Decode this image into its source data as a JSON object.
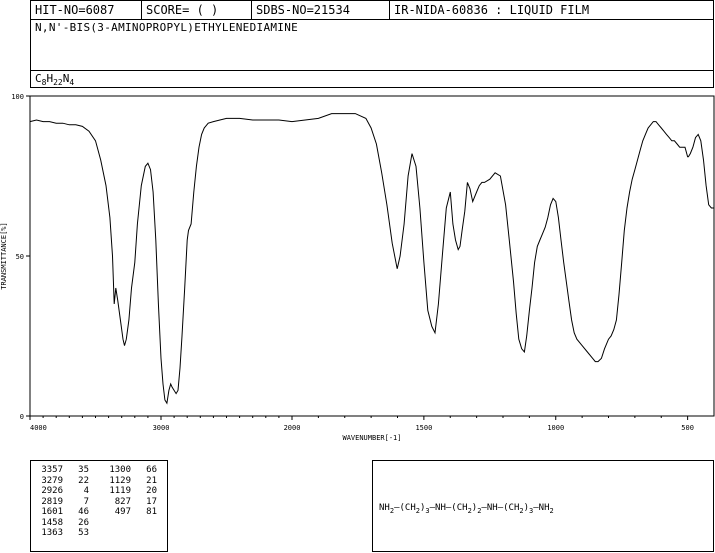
{
  "header": {
    "hit_no": "HIT-NO=6087",
    "score": "SCORE=  (  )",
    "sdbs_no": "SDBS-NO=21534",
    "ir": "IR-NIDA-60836 : LIQUID FILM"
  },
  "compound": {
    "name": "N,N'-BIS(3-AMINOPROPYL)ETHYLENEDIAMINE",
    "formula_c": "C",
    "formula_c_sub": "8",
    "formula_h": "H",
    "formula_h_sub": "22",
    "formula_n": "N",
    "formula_n_sub": "4"
  },
  "chart_data": {
    "type": "line",
    "title": "",
    "xlabel": "WAVENUMBER[-1]",
    "ylabel": "TRANSMITTANCE[%]",
    "xlim": [
      4000,
      400
    ],
    "ylim": [
      0,
      100
    ],
    "x_ticks": [
      4000,
      3000,
      2000,
      1500,
      1000,
      500
    ],
    "y_ticks": [
      0,
      50,
      100
    ],
    "series": [
      {
        "x": [
          4000,
          3950,
          3900,
          3850,
          3800,
          3750,
          3700,
          3650,
          3600,
          3550,
          3500,
          3460,
          3420,
          3390,
          3370,
          3357,
          3345,
          3330,
          3310,
          3290,
          3279,
          3265,
          3245,
          3225,
          3200,
          3180,
          3150,
          3120,
          3100,
          3080,
          3060,
          3040,
          3020,
          3000,
          2985,
          2970,
          2955,
          2940,
          2926,
          2915,
          2900,
          2885,
          2870,
          2855,
          2840,
          2819,
          2800,
          2790,
          2770,
          2750,
          2730,
          2710,
          2690,
          2670,
          2640,
          2600,
          2550,
          2500,
          2450,
          2400,
          2300,
          2200,
          2100,
          2000,
          1900,
          1850,
          1800,
          1760,
          1720,
          1700,
          1680,
          1660,
          1640,
          1620,
          1601,
          1590,
          1575,
          1560,
          1545,
          1530,
          1515,
          1500,
          1485,
          1470,
          1458,
          1445,
          1430,
          1415,
          1400,
          1390,
          1380,
          1370,
          1363,
          1355,
          1345,
          1335,
          1325,
          1315,
          1300,
          1290,
          1280,
          1270,
          1250,
          1230,
          1210,
          1190,
          1175,
          1160,
          1150,
          1140,
          1129,
          1119,
          1110,
          1100,
          1090,
          1080,
          1070,
          1060,
          1050,
          1040,
          1030,
          1020,
          1010,
          1000,
          990,
          980,
          970,
          960,
          950,
          940,
          930,
          920,
          900,
          880,
          860,
          850,
          840,
          827,
          815,
          800,
          790,
          780,
          770,
          760,
          750,
          740,
          730,
          720,
          710,
          700,
          690,
          680,
          670,
          660,
          650,
          640,
          630,
          620,
          610,
          600,
          590,
          580,
          570,
          560,
          550,
          540,
          530,
          520,
          510,
          500,
          497,
          490,
          480,
          470,
          460,
          450,
          440,
          430,
          420,
          410,
          400
        ],
        "y": [
          92,
          92.5,
          92,
          92,
          91.5,
          91.5,
          91,
          91,
          90.5,
          89,
          86,
          80,
          72,
          62,
          50,
          35,
          40,
          36,
          30,
          24,
          22,
          24,
          30,
          40,
          48,
          60,
          72,
          78,
          79,
          77,
          70,
          55,
          35,
          18,
          10,
          5,
          4,
          8,
          10,
          9,
          8,
          7,
          8,
          15,
          25,
          40,
          55,
          58,
          60,
          70,
          78,
          84,
          88,
          90,
          91.5,
          92,
          92.5,
          93,
          93,
          93,
          92.5,
          92.5,
          92.5,
          92,
          93,
          94.5,
          94.5,
          94.5,
          93,
          90,
          85,
          76,
          66,
          54,
          46,
          50,
          60,
          75,
          82,
          78,
          65,
          48,
          33,
          28,
          26,
          35,
          50,
          65,
          70,
          60,
          55,
          52,
          53,
          58,
          64,
          73,
          71,
          67,
          70,
          72,
          73,
          73,
          74,
          76,
          75,
          66,
          54,
          42,
          32,
          24,
          21,
          20,
          25,
          33,
          40,
          48,
          53,
          55,
          57,
          59,
          62,
          66,
          68,
          67,
          62,
          55,
          48,
          42,
          36,
          30,
          26,
          24,
          22,
          20,
          18,
          17,
          17,
          18,
          21,
          24,
          25,
          27,
          30,
          38,
          48,
          58,
          65,
          70,
          74,
          77,
          80,
          83,
          86,
          88,
          90,
          91,
          92,
          92,
          91,
          90,
          89,
          88,
          87,
          86,
          86,
          85,
          84,
          84,
          84,
          81,
          81,
          82,
          84,
          87,
          88,
          86,
          80,
          72,
          66,
          65,
          65
        ]
      }
    ]
  },
  "peaks": [
    {
      "wn": "3357",
      "t": "35"
    },
    {
      "wn": "3279",
      "t": "22"
    },
    {
      "wn": "2926",
      "t": "4"
    },
    {
      "wn": "2819",
      "t": "7"
    },
    {
      "wn": "1601",
      "t": "46"
    },
    {
      "wn": "1458",
      "t": "26"
    },
    {
      "wn": "1363",
      "t": "53"
    },
    {
      "wn": "1300",
      "t": "66"
    },
    {
      "wn": "1129",
      "t": "21"
    },
    {
      "wn": "1119",
      "t": "20"
    },
    {
      "wn": "827",
      "t": "17"
    },
    {
      "wn": "497",
      "t": "81"
    }
  ],
  "structure": {
    "nh2_left": "NH",
    "nh2_left_sub": "2",
    "ch2_a": "(CH",
    "ch2_a_sub": "2",
    "ch2_a_close": ")",
    "ch2_a_n": "3",
    "nh_a": "NH",
    "ch2_b": "(CH",
    "ch2_b_sub": "2",
    "ch2_b_close": ")",
    "ch2_b_n": "2",
    "nh_b": "NH",
    "ch2_c": "(CH",
    "ch2_c_sub": "2",
    "ch2_c_close": ")",
    "ch2_c_n": "3",
    "nh2_right": "NH",
    "nh2_right_sub": "2"
  }
}
